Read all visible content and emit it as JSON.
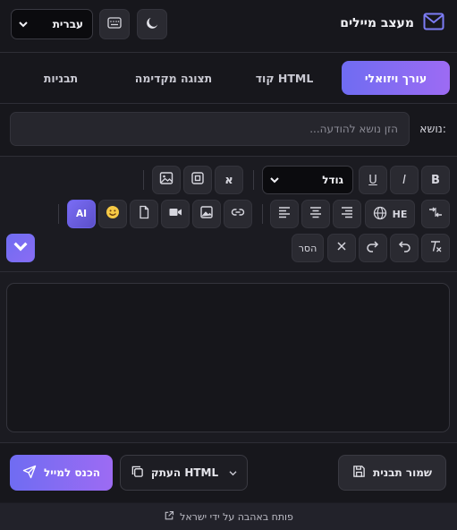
{
  "header": {
    "title": "מעצב מיילים",
    "logo_icon": "mail-icon",
    "language": "עברית"
  },
  "tabs": [
    {
      "label": "עורך ויזואלי",
      "active": true
    },
    {
      "label": "קוד HTML",
      "active": false
    },
    {
      "label": "תצוגה מקדימה",
      "active": false
    },
    {
      "label": "תבניות",
      "active": false
    }
  ],
  "subject": {
    "label": "נושא:",
    "placeholder": "הזן נושא להודעה..."
  },
  "toolbar": {
    "bold": "B",
    "italic": "I",
    "underline": "U",
    "font_size": "גודל",
    "alef": "א",
    "lang_he": "HE",
    "ai": "AI",
    "remove": "הסר"
  },
  "actions": {
    "save_template": "שמור תבנית",
    "copy_html": "העתק HTML",
    "login_mail": "הכנס למייל"
  },
  "footer": {
    "credit": "פותח באהבה על ידי ישראל"
  },
  "colors": {
    "accent_start": "#6f6cf2",
    "accent_end": "#9d6bf3",
    "bg": "#1b1b21"
  }
}
